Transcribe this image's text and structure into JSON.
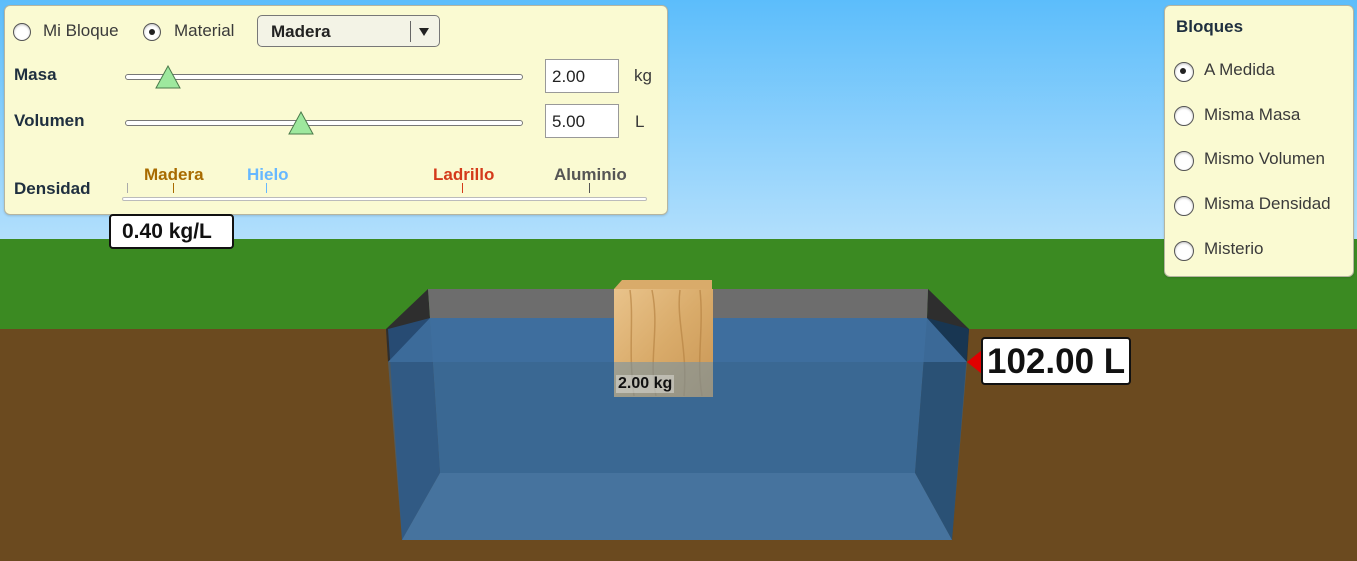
{
  "mode": {
    "options": [
      "Mi Bloque",
      "Material"
    ],
    "selected": "Material"
  },
  "material_select": {
    "value": "Madera"
  },
  "mass": {
    "label": "Masa",
    "value": "2.00",
    "unit": "kg",
    "slider_fraction": 0.11
  },
  "volume": {
    "label": "Volumen",
    "value": "5.00",
    "unit": "L",
    "slider_fraction": 0.44
  },
  "density": {
    "label": "Densidad",
    "readout": "0.40 kg/L",
    "scale_markers": [
      {
        "name": "Madera",
        "color": "#a86b00"
      },
      {
        "name": "Hielo",
        "color": "#66b8ff"
      },
      {
        "name": "Ladrillo",
        "color": "#d43a1a"
      },
      {
        "name": "Aluminio",
        "color": "#555555"
      }
    ]
  },
  "blocks_panel": {
    "title": "Bloques",
    "options": [
      "A Medida",
      "Misma Masa",
      "Mismo Volumen",
      "Misma Densidad",
      "Misterio"
    ],
    "selected": "A Medida"
  },
  "block": {
    "mass_label": "2.00 kg"
  },
  "pool": {
    "volume_readout": "102.00 L"
  },
  "colors": {
    "sky_top": "#5cbdfb",
    "sky_bottom": "#b2dffc",
    "grass": "#3b8a22",
    "ground": "#6b4a1f",
    "water": "#3f6f9e",
    "panel_bg": "#fafad2",
    "thumb": "#9ee89e",
    "marker": "#e00000"
  }
}
